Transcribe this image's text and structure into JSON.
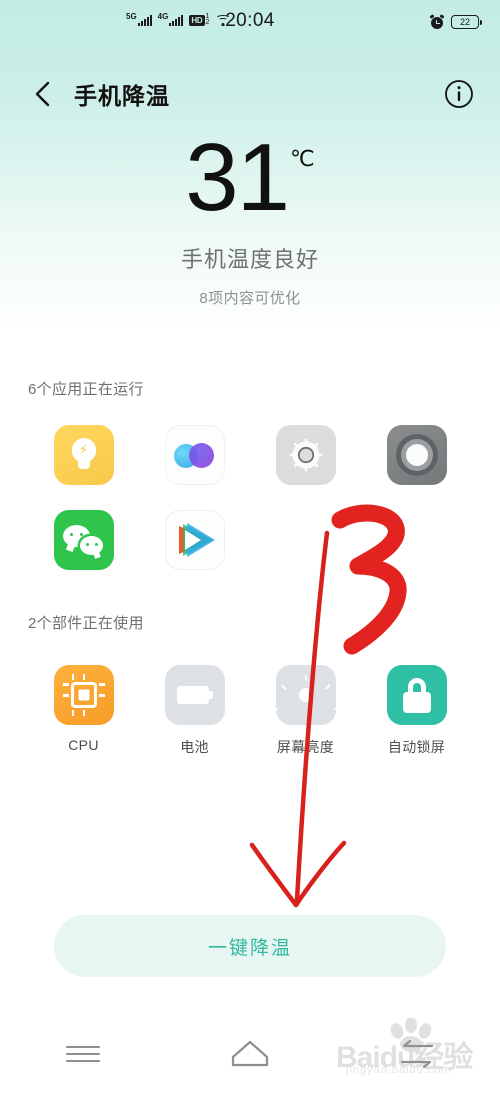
{
  "status_bar": {
    "signal_1_label": "5G",
    "signal_2_label": "4G",
    "hd_label": "HD",
    "hd_sup": "1",
    "hd_sub": "2",
    "wifi_icon": "wifi-icon",
    "time": "20:04",
    "alarm_icon": "alarm-clock-icon",
    "battery_level": "22"
  },
  "header": {
    "back_icon": "chevron-left-icon",
    "title": "手机降温",
    "info_icon": "info-circle-icon"
  },
  "summary": {
    "temperature": "31",
    "unit": "℃",
    "status_text": "手机温度良好",
    "sub_text": "8项内容可优化"
  },
  "apps_section": {
    "title": "6个应用正在运行",
    "items": [
      {
        "name": "app-tile-flashlight",
        "icon": "lightbulb-icon",
        "color": "#f8c84a"
      },
      {
        "name": "app-tile-browser",
        "icon": "two-circles-icon",
        "color": "#35a8e8"
      },
      {
        "name": "app-tile-settings",
        "icon": "gear-icon",
        "color": "#dcdcdc"
      },
      {
        "name": "app-tile-camera",
        "icon": "camera-lens-icon",
        "color": "#75797a"
      },
      {
        "name": "app-tile-wechat",
        "icon": "wechat-icon",
        "color": "#2fc44c"
      },
      {
        "name": "app-tile-tencent-video",
        "icon": "play-triangle-icon",
        "color": "#35b8e8"
      }
    ]
  },
  "components_section": {
    "title": "2个部件正在使用",
    "items": [
      {
        "label": "CPU",
        "icon": "cpu-chip-icon",
        "color": "#f79c28"
      },
      {
        "label": "电池",
        "icon": "battery-icon",
        "color": "#dde1e6"
      },
      {
        "label": "屏幕亮度",
        "icon": "brightness-sun-icon",
        "color": "#dde1e6"
      },
      {
        "label": "自动锁屏",
        "icon": "lock-icon",
        "color": "#2fbfa5"
      }
    ]
  },
  "action": {
    "cool_down_label": "一键降温",
    "accent_color": "#31b8a0",
    "background_color": "#e8f6f2"
  },
  "nav_bar": {
    "recents_icon": "hamburger-menu-icon",
    "home_icon": "home-outline-icon",
    "back_icon": "back-arrow-icon"
  },
  "annotation": {
    "step_number": "3",
    "color": "#e2231f",
    "arrow": "down-arrow-annotation"
  },
  "watermark": {
    "text": "Baidu经验",
    "sub": "jingyan.baidu.com"
  }
}
